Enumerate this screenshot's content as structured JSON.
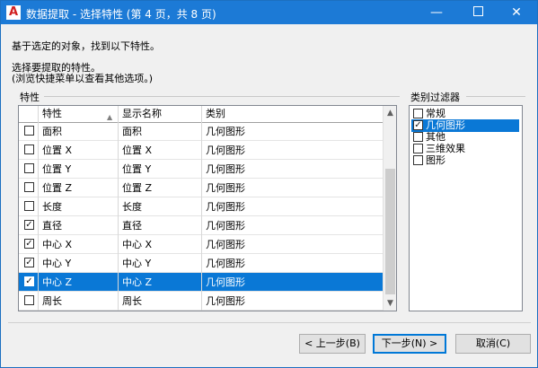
{
  "window": {
    "app_icon": "A",
    "title": "数据提取 - 选择特性 (第 4 页，共 8 页)",
    "minimize": "—",
    "close": "✕"
  },
  "intro": {
    "line1": "基于选定的对象，找到以下特性。",
    "line2": "选择要提取的特性。",
    "line3": "(浏览快捷菜单以查看其他选项。)"
  },
  "properties": {
    "group_label": "特性",
    "columns": [
      "特性",
      "显示名称",
      "类别"
    ],
    "rows": [
      {
        "name": "面积",
        "display": "面积",
        "category": "几何图形",
        "checked": false,
        "selected": false
      },
      {
        "name": "位置 X",
        "display": "位置 X",
        "category": "几何图形",
        "checked": false,
        "selected": false
      },
      {
        "name": "位置 Y",
        "display": "位置 Y",
        "category": "几何图形",
        "checked": false,
        "selected": false
      },
      {
        "name": "位置 Z",
        "display": "位置 Z",
        "category": "几何图形",
        "checked": false,
        "selected": false
      },
      {
        "name": "长度",
        "display": "长度",
        "category": "几何图形",
        "checked": false,
        "selected": false
      },
      {
        "name": "直径",
        "display": "直径",
        "category": "几何图形",
        "checked": true,
        "selected": false
      },
      {
        "name": "中心 X",
        "display": "中心 X",
        "category": "几何图形",
        "checked": true,
        "selected": false
      },
      {
        "name": "中心 Y",
        "display": "中心 Y",
        "category": "几何图形",
        "checked": true,
        "selected": false
      },
      {
        "name": "中心 Z",
        "display": "中心 Z",
        "category": "几何图形",
        "checked": true,
        "selected": true
      },
      {
        "name": "周长",
        "display": "周长",
        "category": "几何图形",
        "checked": false,
        "selected": false
      }
    ]
  },
  "category_filter": {
    "group_label": "类别过滤器",
    "items": [
      {
        "label": "常规",
        "checked": false,
        "selected": false
      },
      {
        "label": "几何图形",
        "checked": true,
        "selected": true
      },
      {
        "label": "其他",
        "checked": false,
        "selected": false
      },
      {
        "label": "三维效果",
        "checked": false,
        "selected": false
      },
      {
        "label": "图形",
        "checked": false,
        "selected": false
      }
    ]
  },
  "buttons": {
    "back": "< 上一步(B)",
    "next": "下一步(N) >",
    "cancel": "取消(C)"
  },
  "colors": {
    "titlebar": "#1c7ad6",
    "selection": "#0a78d6",
    "dialog_bg": "#f0f0f0"
  }
}
